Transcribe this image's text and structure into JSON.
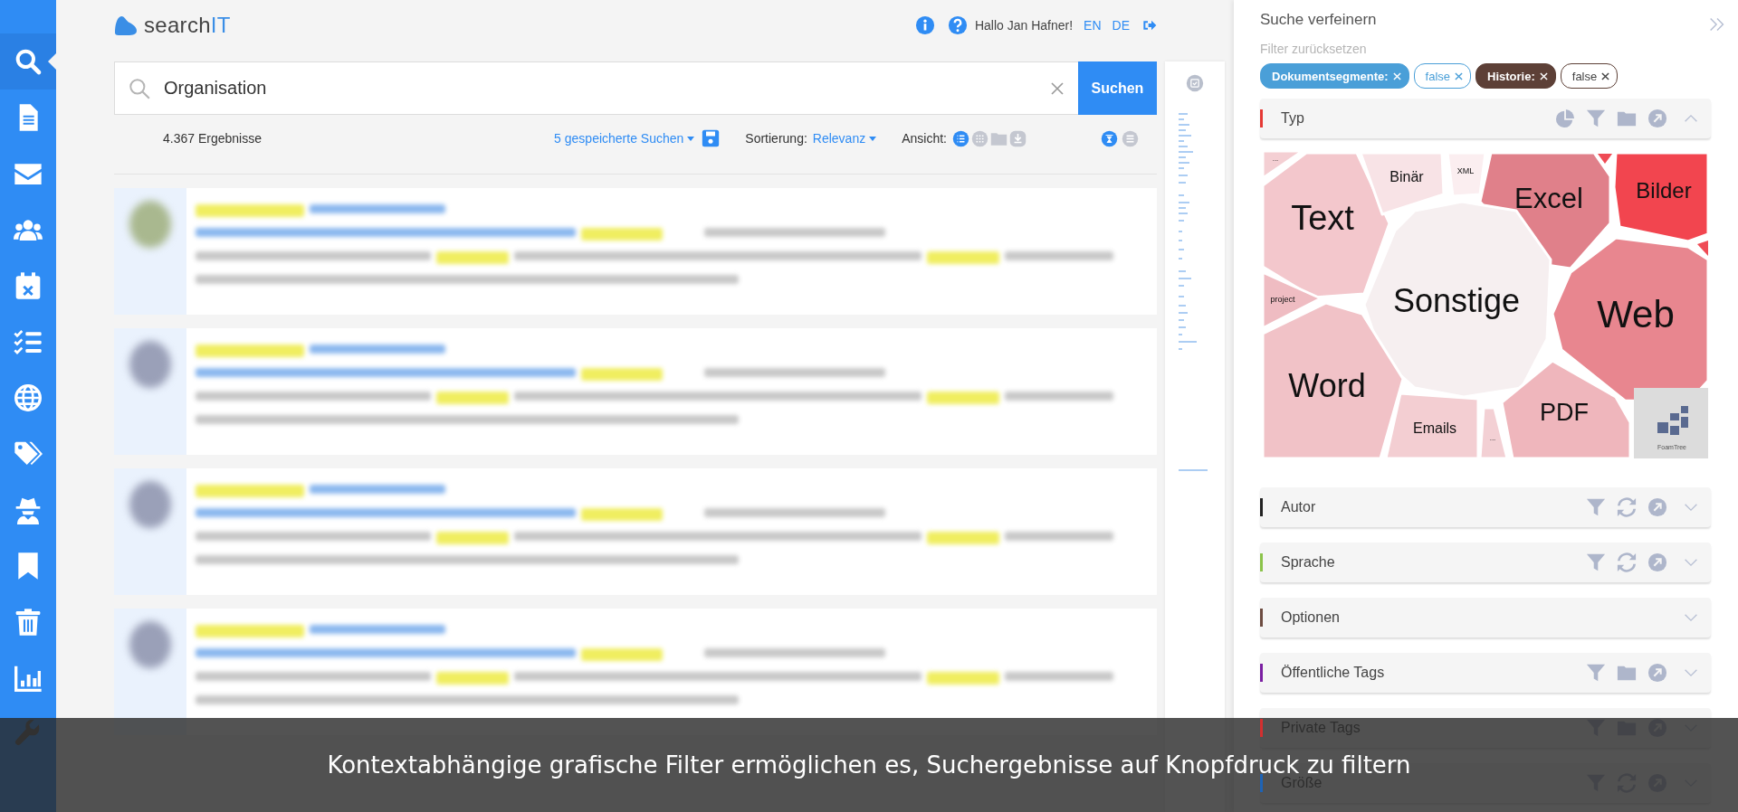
{
  "sidebar": {
    "items": [
      {
        "kind": "search",
        "selected": true
      },
      {
        "kind": "document",
        "selected": false
      },
      {
        "kind": "mail",
        "selected": false
      },
      {
        "kind": "users",
        "selected": false
      },
      {
        "kind": "calendar",
        "selected": false
      },
      {
        "kind": "tasks",
        "selected": false
      },
      {
        "kind": "globe",
        "selected": false
      },
      {
        "kind": "tags",
        "selected": false
      },
      {
        "kind": "agent",
        "selected": false
      },
      {
        "kind": "bookmark",
        "selected": false
      },
      {
        "kind": "trash",
        "selected": false
      },
      {
        "kind": "chart",
        "selected": false
      },
      {
        "kind": "wrench",
        "selected": false
      }
    ]
  },
  "header": {
    "logo": {
      "main": "search",
      "accent": "IT"
    },
    "greeting": "Hallo Jan Hafner!",
    "languages": [
      "EN",
      "DE"
    ]
  },
  "search": {
    "value": "Organisation",
    "button": "Suchen"
  },
  "toolbar": {
    "result_count": "4.367 Ergebnisse",
    "saved_searches": "5 gespeicherte Suchen",
    "sort_label": "Sortierung:",
    "sort_value": "Relevanz",
    "view_label": "Ansicht:",
    "views": [
      {
        "kind": "list",
        "selected": true
      },
      {
        "kind": "grid",
        "selected": false
      },
      {
        "kind": "folder",
        "selected": false
      },
      {
        "kind": "export",
        "selected": false
      }
    ],
    "modes": [
      {
        "kind": "collapse",
        "selected": true
      },
      {
        "kind": "layers",
        "selected": false
      }
    ]
  },
  "refine": {
    "title": "Suche verfeinern",
    "reset": "Filter zurücksetzen",
    "chips": [
      {
        "kind": "key",
        "label": "Dokumentsegmente:",
        "color": "#4a9fd8"
      },
      {
        "kind": "value",
        "label": "false",
        "color": "#4a9fd8"
      },
      {
        "kind": "key",
        "label": "Historie:",
        "color": "#5d4037"
      },
      {
        "kind": "value",
        "label": "false",
        "color": "#5d4037"
      }
    ],
    "facets": [
      {
        "label": "Typ",
        "color": "#e53935",
        "expanded": true,
        "kind": "chart"
      },
      {
        "label": "Autor",
        "color": "#222222",
        "expanded": false,
        "kind": "sync"
      },
      {
        "label": "Sprache",
        "color": "#8bc34a",
        "expanded": false,
        "kind": "sync"
      },
      {
        "label": "Optionen",
        "color": "#6d4c41",
        "expanded": false,
        "kind": "plain"
      },
      {
        "label": "Öffentliche Tags",
        "color": "#7b1fa2",
        "expanded": false,
        "kind": "tags"
      },
      {
        "label": "Private Tags",
        "color": "#d32f2f",
        "expanded": false,
        "kind": "tags"
      },
      {
        "label": "Größe",
        "color": "#1e63b5",
        "expanded": false,
        "kind": "sync"
      }
    ],
    "treemap": {
      "logo": "FoamTree",
      "cells": [
        {
          "label": "...",
          "color": "#f4cfd3"
        },
        {
          "label": "Text",
          "color": "#f3c7cc"
        },
        {
          "label": "Binär",
          "color": "#f8e3e6"
        },
        {
          "label": "XML",
          "color": "#fbeef0"
        },
        {
          "label": "Excel",
          "color": "#e0808a"
        },
        {
          "label": "Bilder",
          "color": "#f2454f"
        },
        {
          "label": "project",
          "color": "#efbcc2"
        },
        {
          "label": "Sonstige",
          "color": "#f6eff0"
        },
        {
          "label": "Web",
          "color": "#e8868f"
        },
        {
          "label": "Word",
          "color": "#f1c2c7"
        },
        {
          "label": "Emails",
          "color": "#f3ced2"
        },
        {
          "label": "...",
          "color": "#f3d0d4"
        },
        {
          "label": "PDF",
          "color": "#efb6bc"
        }
      ]
    }
  },
  "caption": "Kontextabhängige grafische Filter ermöglichen es, Suchergebnisse auf Knopfdruck zu filtern"
}
